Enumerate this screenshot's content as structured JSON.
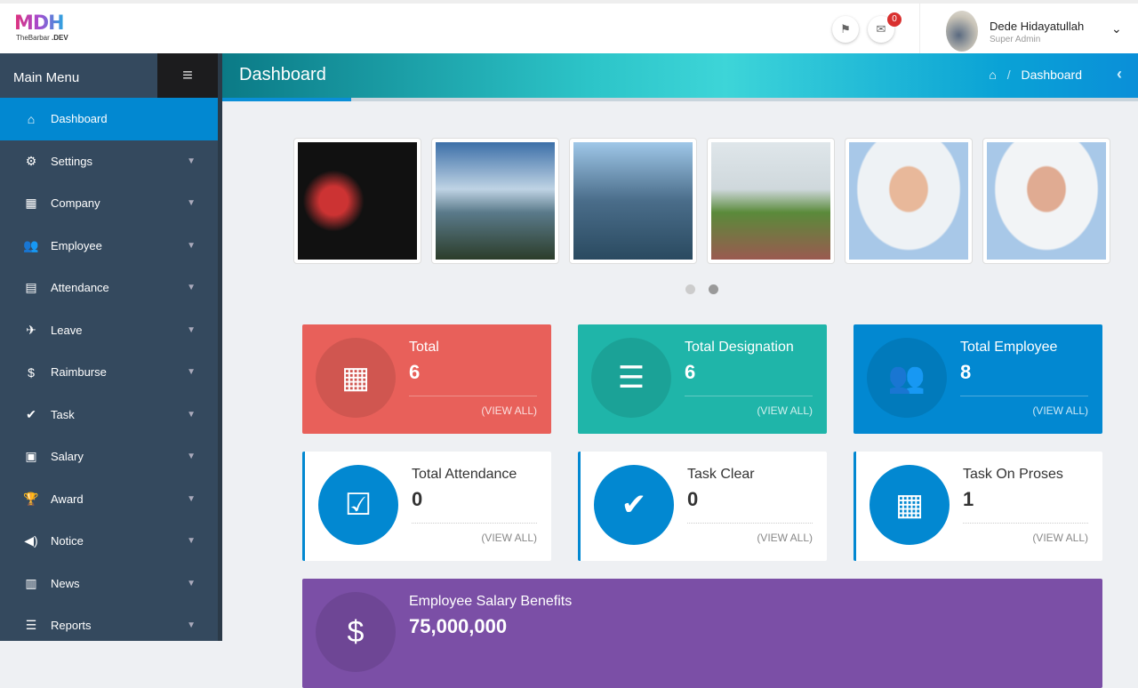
{
  "brand": {
    "logo_text": "MDH",
    "logo_sub": "TheBarbar.DEV"
  },
  "topbar": {
    "notification_count": "0",
    "user_name": "Dede Hidayatullah",
    "user_role": "Super Admin"
  },
  "sidebar": {
    "title": "Main Menu",
    "items": [
      {
        "label": "Dashboard",
        "icon": "⌂"
      },
      {
        "label": "Settings",
        "icon": "⚙"
      },
      {
        "label": "Company",
        "icon": "▦"
      },
      {
        "label": "Employee",
        "icon": "👥"
      },
      {
        "label": "Attendance",
        "icon": "▤"
      },
      {
        "label": "Leave",
        "icon": "✈"
      },
      {
        "label": "Raimburse",
        "icon": "$"
      },
      {
        "label": "Task",
        "icon": "✔"
      },
      {
        "label": "Salary",
        "icon": "▣"
      },
      {
        "label": "Award",
        "icon": "🏆"
      },
      {
        "label": "Notice",
        "icon": "◀)"
      },
      {
        "label": "News",
        "icon": "▥"
      },
      {
        "label": "Reports",
        "icon": "☰"
      }
    ]
  },
  "page": {
    "title": "Dashboard",
    "breadcrumb": "Dashboard",
    "breadcrumb_sep": "/"
  },
  "cards": [
    {
      "title": "Total",
      "value": "6",
      "link": "(VIEW ALL)",
      "color": "#e8605a",
      "icon": "▦"
    },
    {
      "title": "Total Designation",
      "value": "6",
      "link": "(VIEW ALL)",
      "color": "#1fb5a9",
      "icon": "☰"
    },
    {
      "title": "Total Employee",
      "value": "8",
      "link": "(VIEW ALL)",
      "color": "#0288d1",
      "icon": "👥"
    },
    {
      "title": "Total Attendance",
      "value": "0",
      "link": "(VIEW ALL)",
      "icon": "☑"
    },
    {
      "title": "Task Clear",
      "value": "0",
      "link": "(VIEW ALL)",
      "icon": "✔"
    },
    {
      "title": "Task On Proses",
      "value": "1",
      "link": "(VIEW ALL)",
      "icon": "▦"
    },
    {
      "title": "Employee Salary Benefits",
      "value": "75,000,000",
      "color": "#7b4fa6",
      "icon": "$"
    }
  ]
}
